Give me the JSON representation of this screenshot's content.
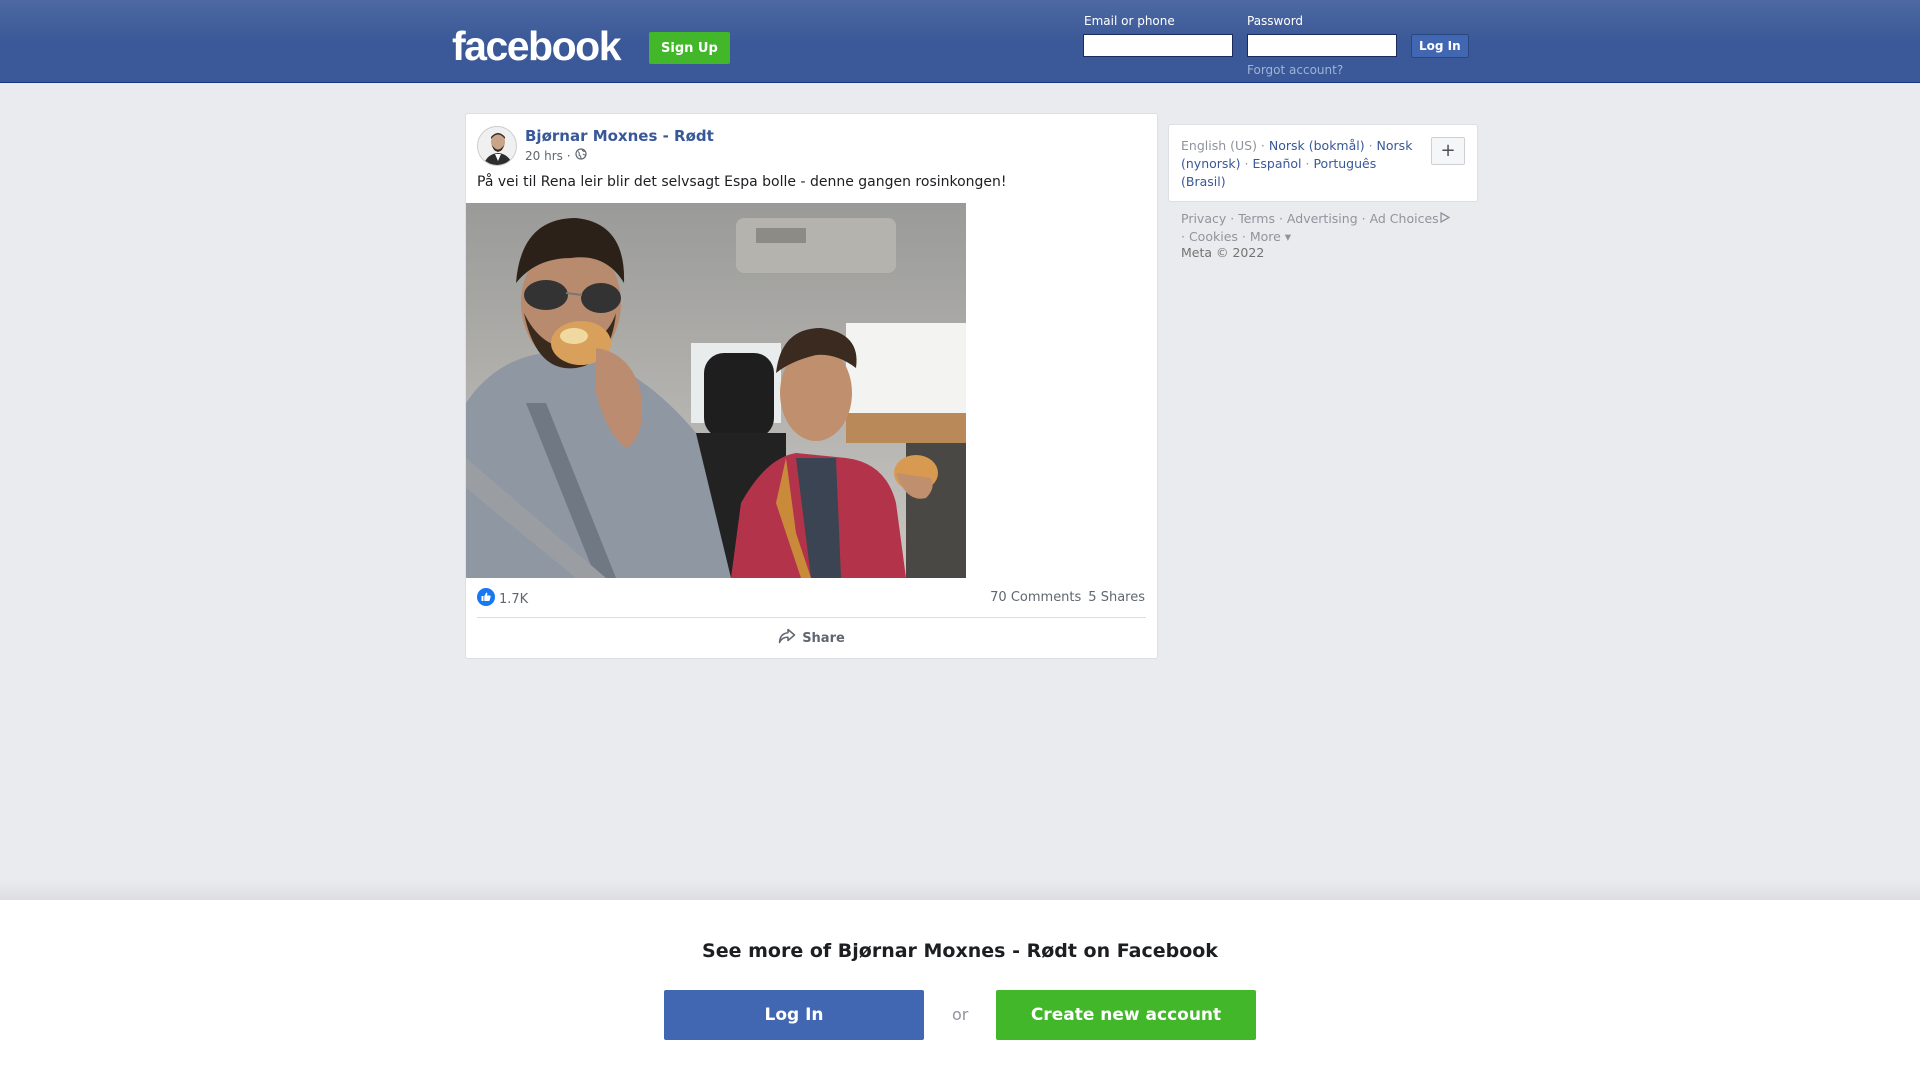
{
  "header": {
    "logo": "facebook",
    "signup_label": "Sign Up",
    "email_label": "Email or phone",
    "password_label": "Password",
    "login_label": "Log In",
    "forgot_label": "Forgot account?"
  },
  "post": {
    "author": "Bjørnar Moxnes - Rødt",
    "time": "20 hrs ·",
    "text": "På vei til Rena leir blir det selvsagt Espa bolle - denne gangen rosinkongen!",
    "likes": "1.7K",
    "comments": "70 Comments",
    "shares": "5 Shares",
    "share_label": "Share"
  },
  "languages": {
    "current": "English (US)",
    "items": [
      "Norsk (bokmål)",
      "Norsk (nynorsk)",
      "Español",
      "Português (Brasil)"
    ],
    "more_button": "+"
  },
  "footer": {
    "links": [
      "Privacy",
      "Terms",
      "Advertising",
      "Ad Choices",
      "Cookies",
      "More"
    ],
    "copyright": "Meta © 2022"
  },
  "bottom": {
    "headline": "See more of Bjørnar Moxnes - Rødt on Facebook",
    "login_label": "Log In",
    "or_label": "or",
    "create_label": "Create new account"
  },
  "colors": {
    "brand": "#3b5998",
    "green": "#42b72a",
    "link": "#385898",
    "background": "#e9ebee"
  }
}
